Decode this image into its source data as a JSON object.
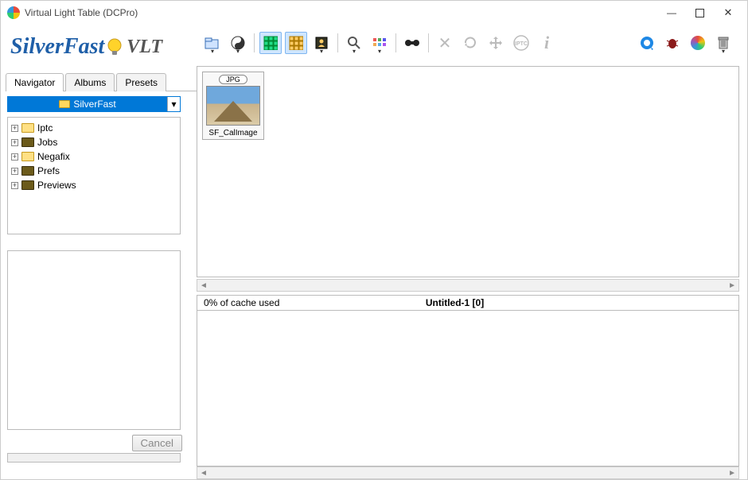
{
  "window": {
    "title": "Virtual Light Table (DCPro)"
  },
  "brand": {
    "silver": "Silver",
    "fast": "Fast",
    "vlt": "VLT"
  },
  "toolbar": {
    "icons": {
      "open": "open-folder",
      "yinyang": "apply",
      "grid1": "grid-green",
      "grid2": "grid-amber",
      "person": "highlight",
      "zoom": "zoom",
      "sort": "sort",
      "find": "find",
      "delete": "delete",
      "refresh": "refresh",
      "move": "move",
      "iptc": "iptc",
      "info": "info",
      "quicktime": "quicktime",
      "bug": "bug",
      "colorwheel": "colorwheel",
      "trash": "trash"
    }
  },
  "tabs": {
    "navigator": "Navigator",
    "albums": "Albums",
    "presets": "Presets"
  },
  "selector": {
    "value": "SilverFast"
  },
  "tree": [
    {
      "label": "Iptc",
      "icon": "yellow"
    },
    {
      "label": "Jobs",
      "icon": "dark"
    },
    {
      "label": "Negafix",
      "icon": "yellow"
    },
    {
      "label": "Prefs",
      "icon": "dark"
    },
    {
      "label": "Previews",
      "icon": "dark"
    }
  ],
  "cancel": "Cancel",
  "thumb": {
    "badge": "JPG",
    "label": "SF_CalImage"
  },
  "status": {
    "cache": "0% of cache used",
    "doc": "Untitled-1 [0]"
  }
}
